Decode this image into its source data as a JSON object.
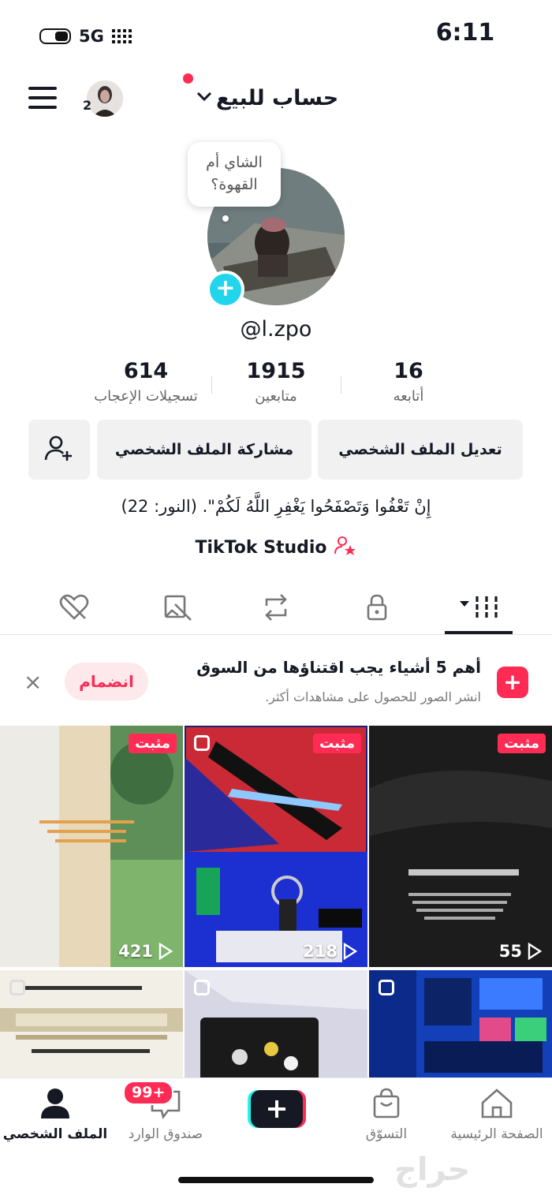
{
  "status_bar": {
    "time": "6:11",
    "network": "5G"
  },
  "header": {
    "avatar_count": "2",
    "account_title": "حساب للبيع"
  },
  "profile": {
    "bubble_text": "الشاي أم القهوة؟",
    "username": "@l.zpo",
    "stats": [
      {
        "value": "16",
        "label": "أتابعه"
      },
      {
        "value": "1915",
        "label": "متابعين"
      },
      {
        "value": "614",
        "label": "تسجيلات الإعجاب"
      }
    ],
    "buttons": {
      "edit": "تعديل الملف الشخصي",
      "share": "مشاركة الملف الشخصي"
    },
    "bio": "إِنْ تَعْفُوا وَتَصْفَحُوا يَغْفِرِ اللَّهُ لَكُمْ\". (النور: 22)",
    "studio": "TikTok Studio"
  },
  "promo": {
    "title": "أهم 5 أشياء يجب اقتناؤها من السوق",
    "subtitle": "انشر الصور للحصول على مشاهدات أكثر.",
    "join": "انضمام",
    "close": "×"
  },
  "videos": [
    {
      "pinned": "مثبت",
      "views": "55"
    },
    {
      "pinned": "مثبت",
      "views": "218"
    },
    {
      "pinned": "مثبت",
      "views": "421"
    }
  ],
  "nav": {
    "home": "الصفحة الرئيسية",
    "shop": "التسوّق",
    "inbox": "صندوق الوارد",
    "inbox_badge": "99+",
    "profile": "الملف الشخصي"
  },
  "watermark": "حراج"
}
